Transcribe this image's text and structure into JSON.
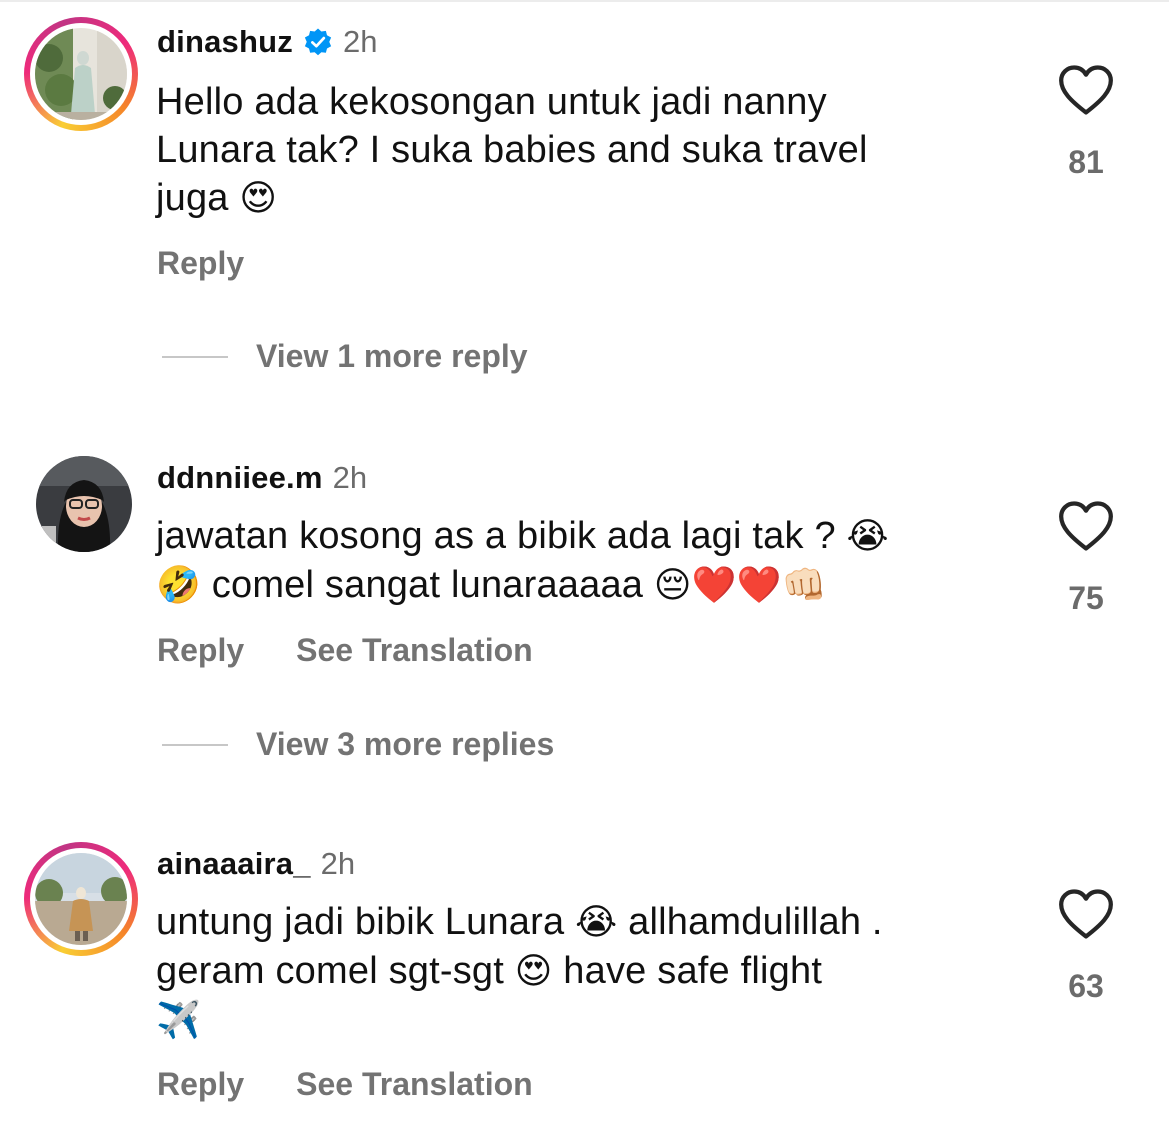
{
  "comments": [
    {
      "username": "dinashuz",
      "verified": true,
      "time": "2h",
      "lines": [
        "Hello ada kekosongan untuk jadi nanny",
        "Lunara tak? I suka babies and suka travel",
        "juga"
      ],
      "emoji_1": "😍",
      "reply_label": "Reply",
      "view_replies": "View 1 more reply",
      "likes": "81",
      "avatar_icon": "avatar-photo"
    },
    {
      "username": "ddnniiee.m",
      "verified": false,
      "time": "2h",
      "lines": [
        "jawatan kosong as a bibik ada lagi tak ?",
        "comel sangat lunaraaaaa"
      ],
      "emoji_1": "😭",
      "emoji_2": "🤣",
      "emoji_3": "😔❤️❤️👊🏻",
      "reply_label": "Reply",
      "translation_label": "See Translation",
      "view_replies": "View 3 more replies",
      "likes": "75",
      "avatar_icon": "avatar-photo"
    },
    {
      "username": "ainaaaira_",
      "verified": false,
      "time": "2h",
      "lines": [
        "untung jadi bibik Lunara",
        "allhamdulillah .",
        "geram comel sgt-sgt",
        "have safe flight"
      ],
      "emoji_1": "😭",
      "emoji_2": "😍",
      "emoji_3": "✈️",
      "reply_label": "Reply",
      "translation_label": "See Translation",
      "likes": "63",
      "avatar_icon": "avatar-photo"
    }
  ],
  "colors": {
    "secondary_text": "#737373",
    "verified_blue": "#0095f6",
    "story_ring": "#ee2a7b"
  }
}
